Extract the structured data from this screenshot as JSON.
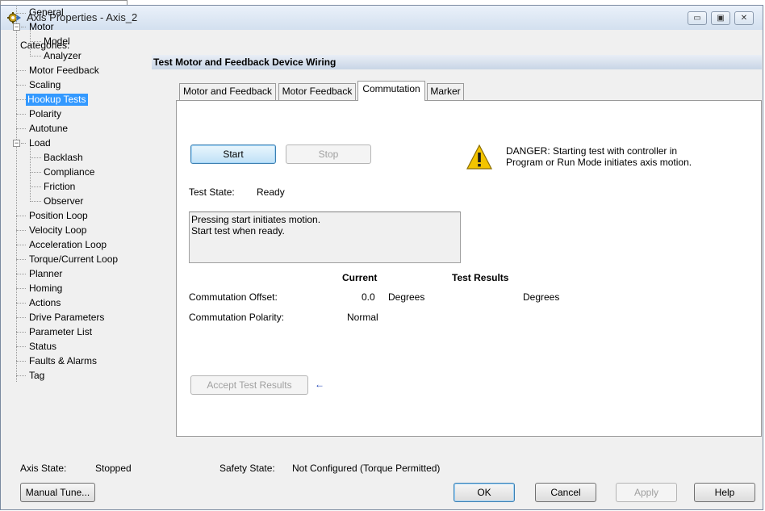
{
  "window": {
    "title": "Axis Properties - Axis_2",
    "controls": {
      "minimize": "▭",
      "maximize": "▣",
      "close": "✕"
    }
  },
  "categories": {
    "label": "Categories:",
    "items": [
      "General",
      "Motor",
      "Model",
      "Analyzer",
      "Motor Feedback",
      "Scaling",
      "Hookup Tests",
      "Polarity",
      "Autotune",
      "Load",
      "Backlash",
      "Compliance",
      "Friction",
      "Observer",
      "Position Loop",
      "Velocity Loop",
      "Acceleration Loop",
      "Torque/Current Loop",
      "Planner",
      "Homing",
      "Actions",
      "Drive Parameters",
      "Parameter List",
      "Status",
      "Faults & Alarms",
      "Tag"
    ],
    "selected": "Hookup Tests"
  },
  "section": {
    "title": "Test Motor and Feedback Device Wiring"
  },
  "tabs": [
    "Motor and Feedback",
    "Motor Feedback",
    "Commutation",
    "Marker"
  ],
  "active_tab": "Commutation",
  "test": {
    "start_label": "Start",
    "stop_label": "Stop",
    "danger_text_1": "DANGER: Starting test with controller in",
    "danger_text_2": "Program or Run Mode initiates axis motion.",
    "state_label": "Test State:",
    "state_value": "Ready",
    "message": "Pressing start initiates motion.\nStart test when ready."
  },
  "results": {
    "current_header": "Current",
    "results_header": "Test Results",
    "offset_label": "Commutation Offset:",
    "offset_value": "0.0",
    "offset_unit": "Degrees",
    "offset_result_unit": "Degrees",
    "polarity_label": "Commutation Polarity:",
    "polarity_value": "Normal",
    "accept_label": "Accept Test Results",
    "arrow": "←"
  },
  "status_bar": {
    "axis_state_label": "Axis State:",
    "axis_state_value": "Stopped",
    "safety_state_label": "Safety State:",
    "safety_state_value": "Not Configured (Torque Permitted)"
  },
  "buttons": {
    "manual_tune": "Manual Tune...",
    "ok": "OK",
    "cancel": "Cancel",
    "apply": "Apply",
    "help": "Help"
  },
  "colors": {
    "selection": "#3399ff",
    "header_band": "#c8d5e6",
    "warning": "#f3c400"
  }
}
